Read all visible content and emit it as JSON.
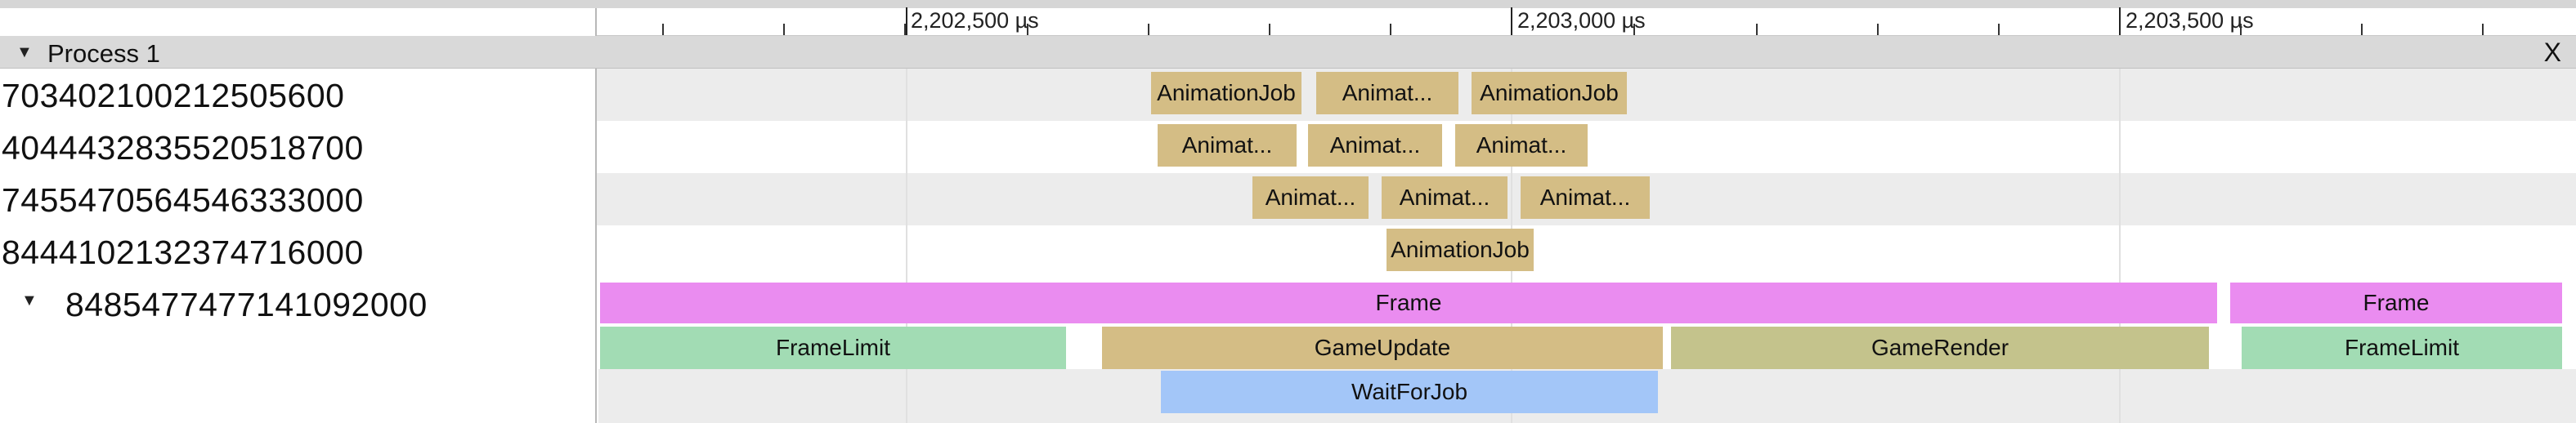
{
  "ruler": {
    "labels": [
      "2,202,500 µs",
      "2,203,000 µs",
      "2,203,500 µs"
    ]
  },
  "process": {
    "title": "Process 1",
    "close": "X"
  },
  "threads": [
    {
      "id": "7034021002125056​00",
      "slices": [
        "AnimationJob",
        "Animat...",
        "AnimationJob"
      ]
    },
    {
      "id": "404443283552051​8700",
      "slices": [
        "Animat...",
        "Animat...",
        "Animat..."
      ]
    },
    {
      "id": "7455470564546333000",
      "slices": [
        "Animat...",
        "Animat...",
        "Animat..."
      ]
    },
    {
      "id": "8444102132374716000",
      "slices": [
        "AnimationJob"
      ]
    },
    {
      "id": "8485477477141092000",
      "frames": [
        "Frame",
        "Frame"
      ],
      "stages": [
        "FrameLimit",
        "GameUpdate",
        "GameRender",
        "FrameLimit"
      ],
      "waits": [
        "WaitForJob"
      ]
    }
  ],
  "colors": {
    "animation_job": "#d4bd85",
    "frame": "#ea8cf0",
    "frame_limit": "#a2dcb4",
    "game_update": "#d4bd85",
    "game_render": "#c4c38c",
    "wait_for_job": "#a3c6f8"
  }
}
